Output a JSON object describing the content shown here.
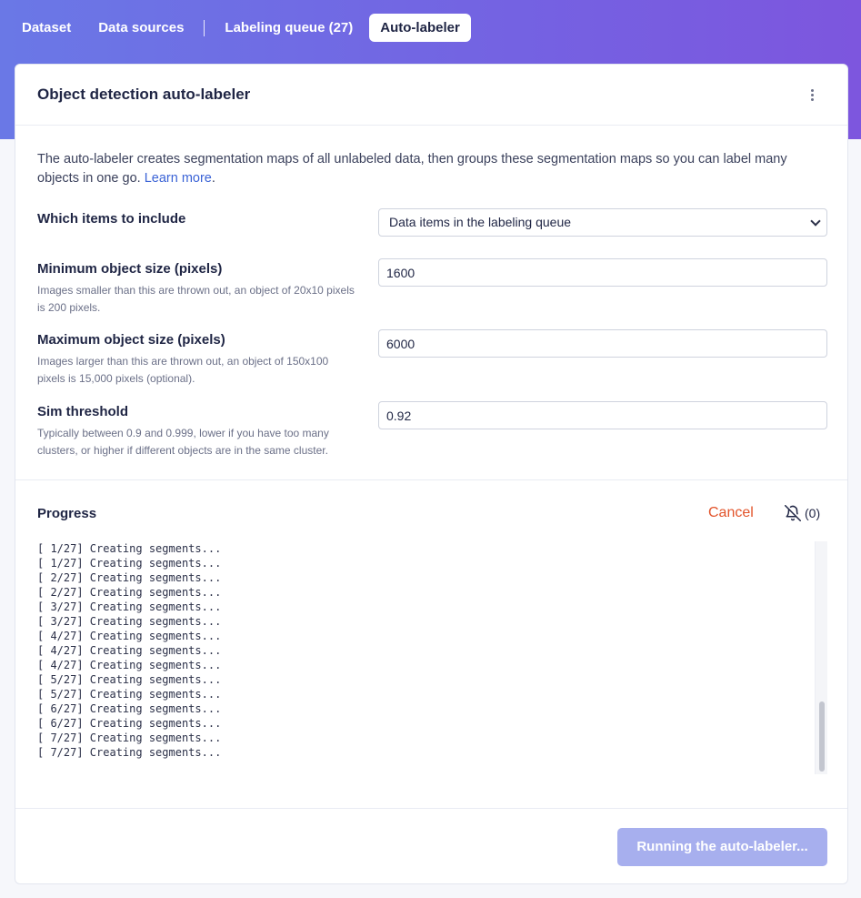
{
  "nav": {
    "items": [
      {
        "label": "Dataset"
      },
      {
        "label": "Data sources"
      },
      {
        "label": "Labeling queue (27)"
      },
      {
        "label": "Auto-labeler"
      }
    ],
    "active": "Auto-labeler"
  },
  "card": {
    "title": "Object detection auto-labeler",
    "menu_icon": "kebab-vertical-icon"
  },
  "description": {
    "text": "The auto-labeler creates segmentation maps of all unlabeled data, then groups these segmentation maps so you can label many objects in one go. ",
    "link": "Learn more",
    "tail": "."
  },
  "form": {
    "include": {
      "label": "Which items to include",
      "selected": "Data items in the labeling queue"
    },
    "min_size": {
      "label": "Minimum object size (pixels)",
      "help": "Images smaller than this are thrown out, an object of 20x10 pixels is 200 pixels.",
      "value": "1600"
    },
    "max_size": {
      "label": "Maximum object size (pixels)",
      "help": "Images larger than this are thrown out, an object of 150x100 pixels is 15,000 pixels (optional).",
      "value": "6000"
    },
    "sim_threshold": {
      "label": "Sim threshold",
      "help": "Typically between 0.9 and 0.999, lower if you have too many clusters, or higher if different objects are in the same cluster.",
      "value": "0.92"
    }
  },
  "progress": {
    "title": "Progress",
    "cancel_label": "Cancel",
    "notify_icon": "bell-off-icon",
    "notify_count": "(0)",
    "log": [
      "[ 1/27] Creating segments...",
      "[ 1/27] Creating segments...",
      "[ 2/27] Creating segments...",
      "[ 2/27] Creating segments...",
      "[ 3/27] Creating segments...",
      "[ 3/27] Creating segments...",
      "[ 4/27] Creating segments...",
      "[ 4/27] Creating segments...",
      "[ 4/27] Creating segments...",
      "[ 5/27] Creating segments...",
      "[ 5/27] Creating segments...",
      "[ 6/27] Creating segments...",
      "[ 6/27] Creating segments...",
      "[ 7/27] Creating segments...",
      "[ 7/27] Creating segments..."
    ]
  },
  "footer": {
    "run_label": "Running the auto-labeler..."
  },
  "colors": {
    "accent": "#3b63d6",
    "cancel": "#e2542b",
    "button_disabled": "#a7afee",
    "header_gradient_start": "#6a78e6",
    "header_gradient_end": "#7d56de"
  }
}
